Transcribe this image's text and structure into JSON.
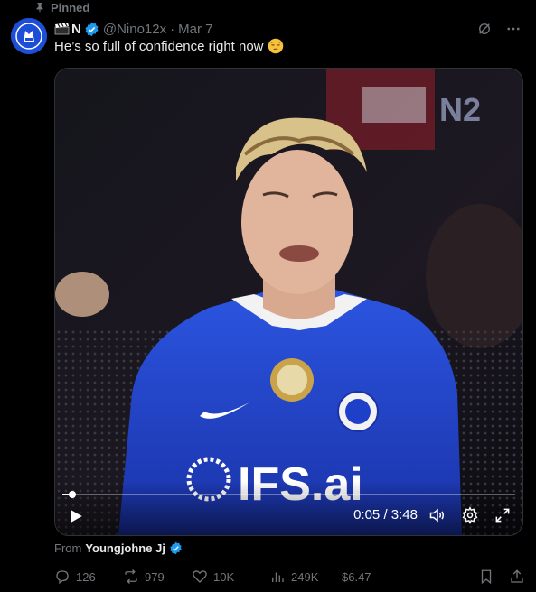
{
  "pinned_label": "Pinned",
  "author": {
    "name": "N",
    "handle": "@Nino12x",
    "date": "Mar 7",
    "verified": true
  },
  "tweet": {
    "text": "He’s so full of confidence right now"
  },
  "media": {
    "watermark": "N2",
    "jersey_sponsor": "IFS.ai",
    "current_time": "0:05",
    "separator": "/",
    "duration": "3:48",
    "progress_fraction": 0.022
  },
  "attribution": {
    "prefix": "From",
    "source": "Youngjohne Jj"
  },
  "actions": {
    "replies": "126",
    "reposts": "979",
    "likes": "10K",
    "views": "249K",
    "tip": "$6.47"
  },
  "colors": {
    "accent": "#1d9bf0",
    "muted": "#71767b",
    "jersey": "#1e40c8"
  }
}
